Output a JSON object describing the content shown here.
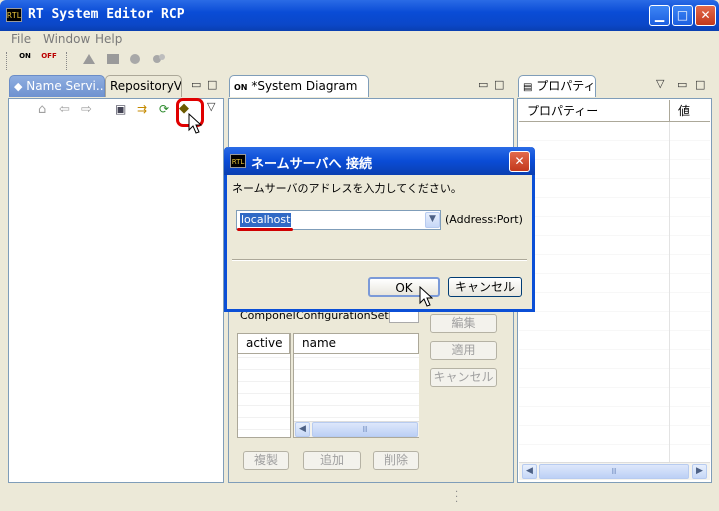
{
  "window": {
    "title": "RT System Editor RCP",
    "icon_label": "RTL",
    "min_glyph": "▁",
    "max_glyph": "□",
    "close_glyph": "✕"
  },
  "menu": [
    {
      "label": "File"
    },
    {
      "label": "Window"
    },
    {
      "label": "Help"
    }
  ],
  "toolbar": {
    "on_label": "ON",
    "off_label": "OFF"
  },
  "left_panel": {
    "tabs": [
      {
        "label": "Name Servi..."
      },
      {
        "label": "RepositoryV..."
      }
    ]
  },
  "center_panel": {
    "tab_label": "*System Diagram",
    "tab_close": "⊠",
    "config_label_1": "Componel",
    "config_label_2": "ConfigurationSet:",
    "columns": [
      "active",
      "name"
    ],
    "side_buttons": [
      "編集",
      "適用",
      "キャンセル"
    ],
    "bottom_buttons": [
      "複製",
      "追加",
      "削除"
    ],
    "scroll_thumb": "Ⅲ"
  },
  "right_panel": {
    "tab_label": "プロパティー",
    "columns": [
      "プロパティー",
      "値"
    ],
    "scroll_thumb": "Ⅲ"
  },
  "dialog": {
    "icon_label": "RTL",
    "title": "ネームサーバへ 接続",
    "prompt": "ネームサーバのアドレスを入力してください。",
    "address_value": "localhost",
    "address_hint": "(Address:Port)",
    "ok_label": "OK",
    "cancel_label": "キャンセル",
    "close_glyph": "✕"
  },
  "colors": {
    "titlebar": "#0A4CD6",
    "highlight_circle": "#E00000",
    "selection": "#316AC5"
  }
}
